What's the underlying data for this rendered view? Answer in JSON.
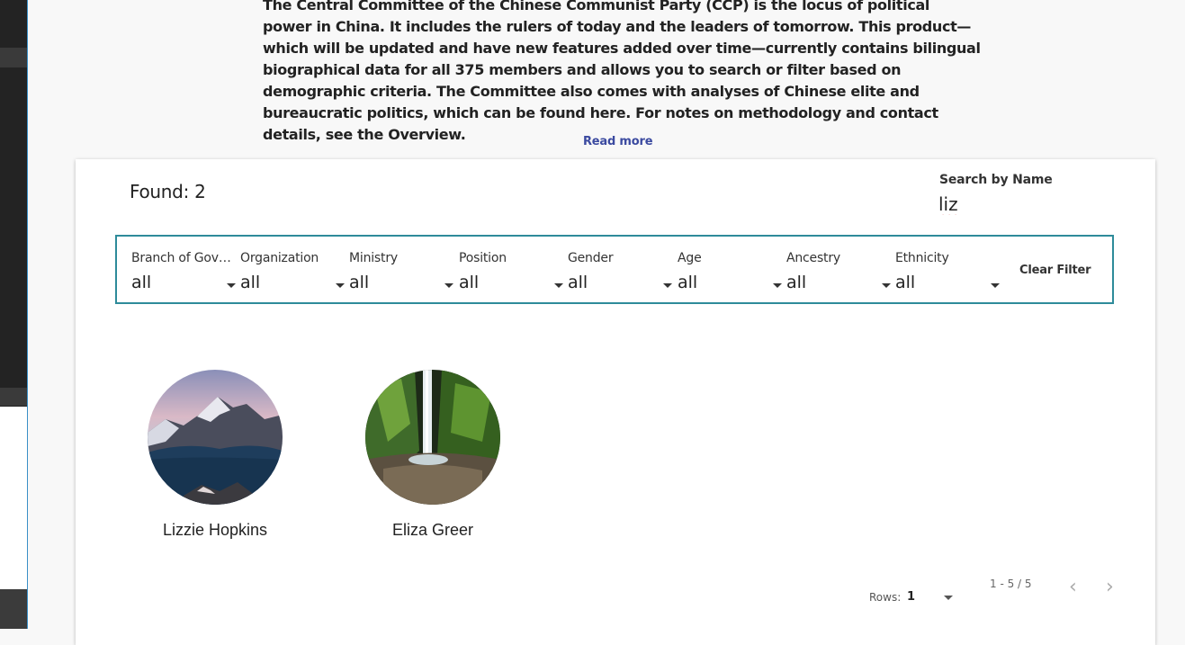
{
  "intro": {
    "text": "The Central Committee of the Chinese Communist Party (CCP) is the locus of political power in China. It includes the rulers of today and the leaders of tomorrow. This product—which will be updated and have new features added over time—currently contains bilingual biographical data for all 375 members and allows you to search or filter based on demographic criteria. The Committee also comes with analyses of Chinese elite and bureaucratic politics, which can be found here. For notes on methodology and contact details, see the Overview.",
    "read_more": "Read more"
  },
  "results": {
    "found_label": "Found: 2"
  },
  "search": {
    "label": "Search by Name",
    "value": "liz"
  },
  "filters": [
    {
      "label": "Branch of Government",
      "value": "all"
    },
    {
      "label": "Organization",
      "value": "all"
    },
    {
      "label": "Ministry",
      "value": "all"
    },
    {
      "label": "Position",
      "value": "all"
    },
    {
      "label": "Gender",
      "value": "all"
    },
    {
      "label": "Age",
      "value": "all"
    },
    {
      "label": "Ancestry",
      "value": "all"
    },
    {
      "label": "Ethnicity",
      "value": "all"
    }
  ],
  "clear_filter": "Clear Filter",
  "people": [
    {
      "name": "Lizzie Hopkins",
      "image": "mountain-lake-photo"
    },
    {
      "name": "Eliza Greer",
      "image": "waterfall-canyon-photo"
    }
  ],
  "pagination": {
    "rows_label": "Rows:",
    "rows_value": "1",
    "range": "1 - 5 / 5"
  },
  "colors": {
    "filter_border": "#2e8b9a",
    "link": "#3b4aa0"
  }
}
